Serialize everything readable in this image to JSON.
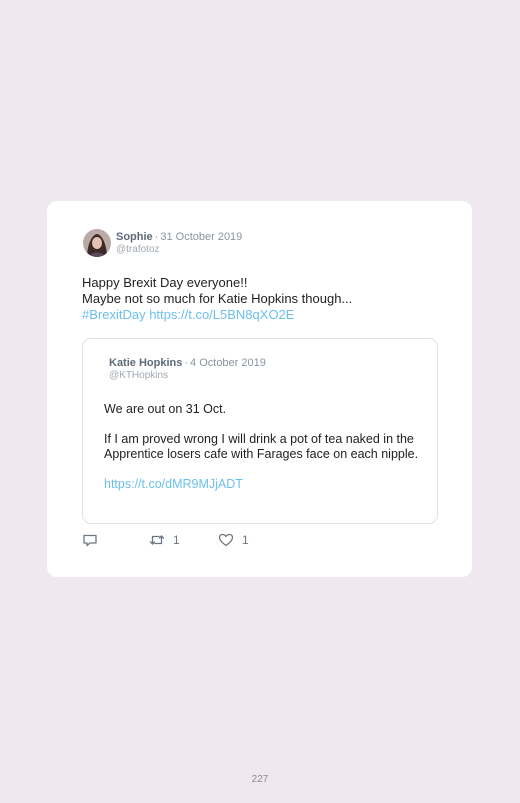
{
  "tweet": {
    "author": {
      "name": "Sophie",
      "date": "31 October 2019",
      "handle": "@trafotoz"
    },
    "text_lines": [
      "Happy Brexit Day everyone!!",
      "Maybe not so much for Katie Hopkins though..."
    ],
    "hashtag": "#BrexitDay",
    "link": "https://t.co/L5BN8qXO2E",
    "actions": {
      "retweets": "1",
      "likes": "1"
    }
  },
  "quoted_tweet": {
    "author": {
      "name": "Katie Hopkins",
      "date": "4 October 2019",
      "handle": "@KTHopkins"
    },
    "paragraph1": "We are out on 31 Oct.",
    "paragraph2": "If I am proved wrong I will drink a pot of tea naked in the Apprentice losers cafe with Farages face on each nipple.",
    "link": "https://t.co/dMR9MJjADT"
  },
  "page_number": "227",
  "colors": {
    "background": "#efe8ee",
    "card": "#ffffff",
    "link": "#6cc0ec"
  },
  "icons": [
    "avatar",
    "reply-icon",
    "retweet-icon",
    "like-icon"
  ]
}
